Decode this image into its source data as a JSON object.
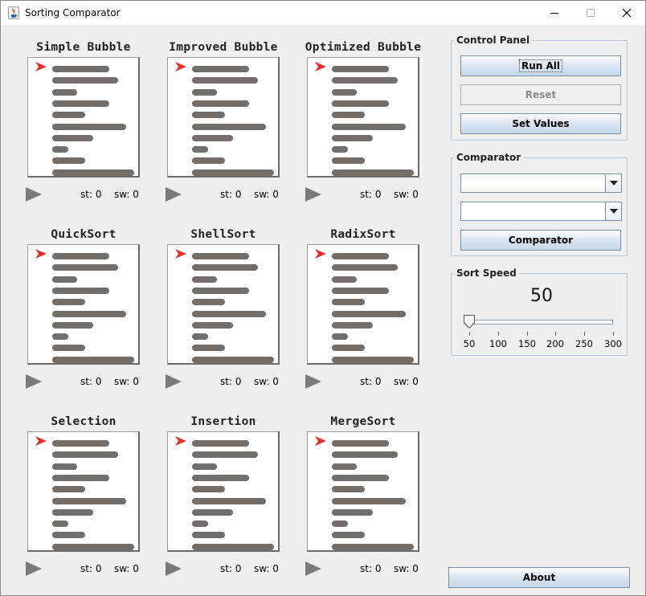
{
  "window": {
    "title": "Sorting Comparator",
    "icon": "java-cup-icon",
    "controls": [
      "minimize-icon",
      "maximize-icon",
      "close-icon"
    ]
  },
  "sort_panels": [
    {
      "title": "Simple Bubble",
      "st": "st: 0",
      "sw": "sw: 0"
    },
    {
      "title": "Improved Bubble",
      "st": "st: 0",
      "sw": "sw: 0"
    },
    {
      "title": "Optimized Bubble",
      "st": "st: 0",
      "sw": "sw: 0"
    },
    {
      "title": "QuickSort",
      "st": "st: 0",
      "sw": "sw: 0"
    },
    {
      "title": "ShellSort",
      "st": "st: 0",
      "sw": "sw: 0"
    },
    {
      "title": "RadixSort",
      "st": "st: 0",
      "sw": "sw: 0"
    },
    {
      "title": "Selection",
      "st": "st: 0",
      "sw": "sw: 0"
    },
    {
      "title": "Insertion",
      "st": "st: 0",
      "sw": "sw: 0"
    },
    {
      "title": "MergeSort",
      "st": "st: 0",
      "sw": "sw: 0"
    }
  ],
  "bar_values": [
    7,
    8,
    3,
    7,
    4,
    9,
    5,
    2,
    4,
    10
  ],
  "colors": {
    "bar": "#726e6c",
    "pointer": "#e0322b",
    "play": "#7a7a7a"
  },
  "control_panel": {
    "legend": "Control Panel",
    "run_all": "Run All",
    "reset": "Reset",
    "set_values": "Set Values"
  },
  "comparator": {
    "legend": "Comparator",
    "combo1_value": "",
    "combo2_value": "",
    "button": "Comparator"
  },
  "sort_speed": {
    "legend": "Sort Speed",
    "value": "50",
    "min": 50,
    "max": 300,
    "ticks": [
      "50",
      "100",
      "150",
      "200",
      "250",
      "300"
    ]
  },
  "about": "About"
}
